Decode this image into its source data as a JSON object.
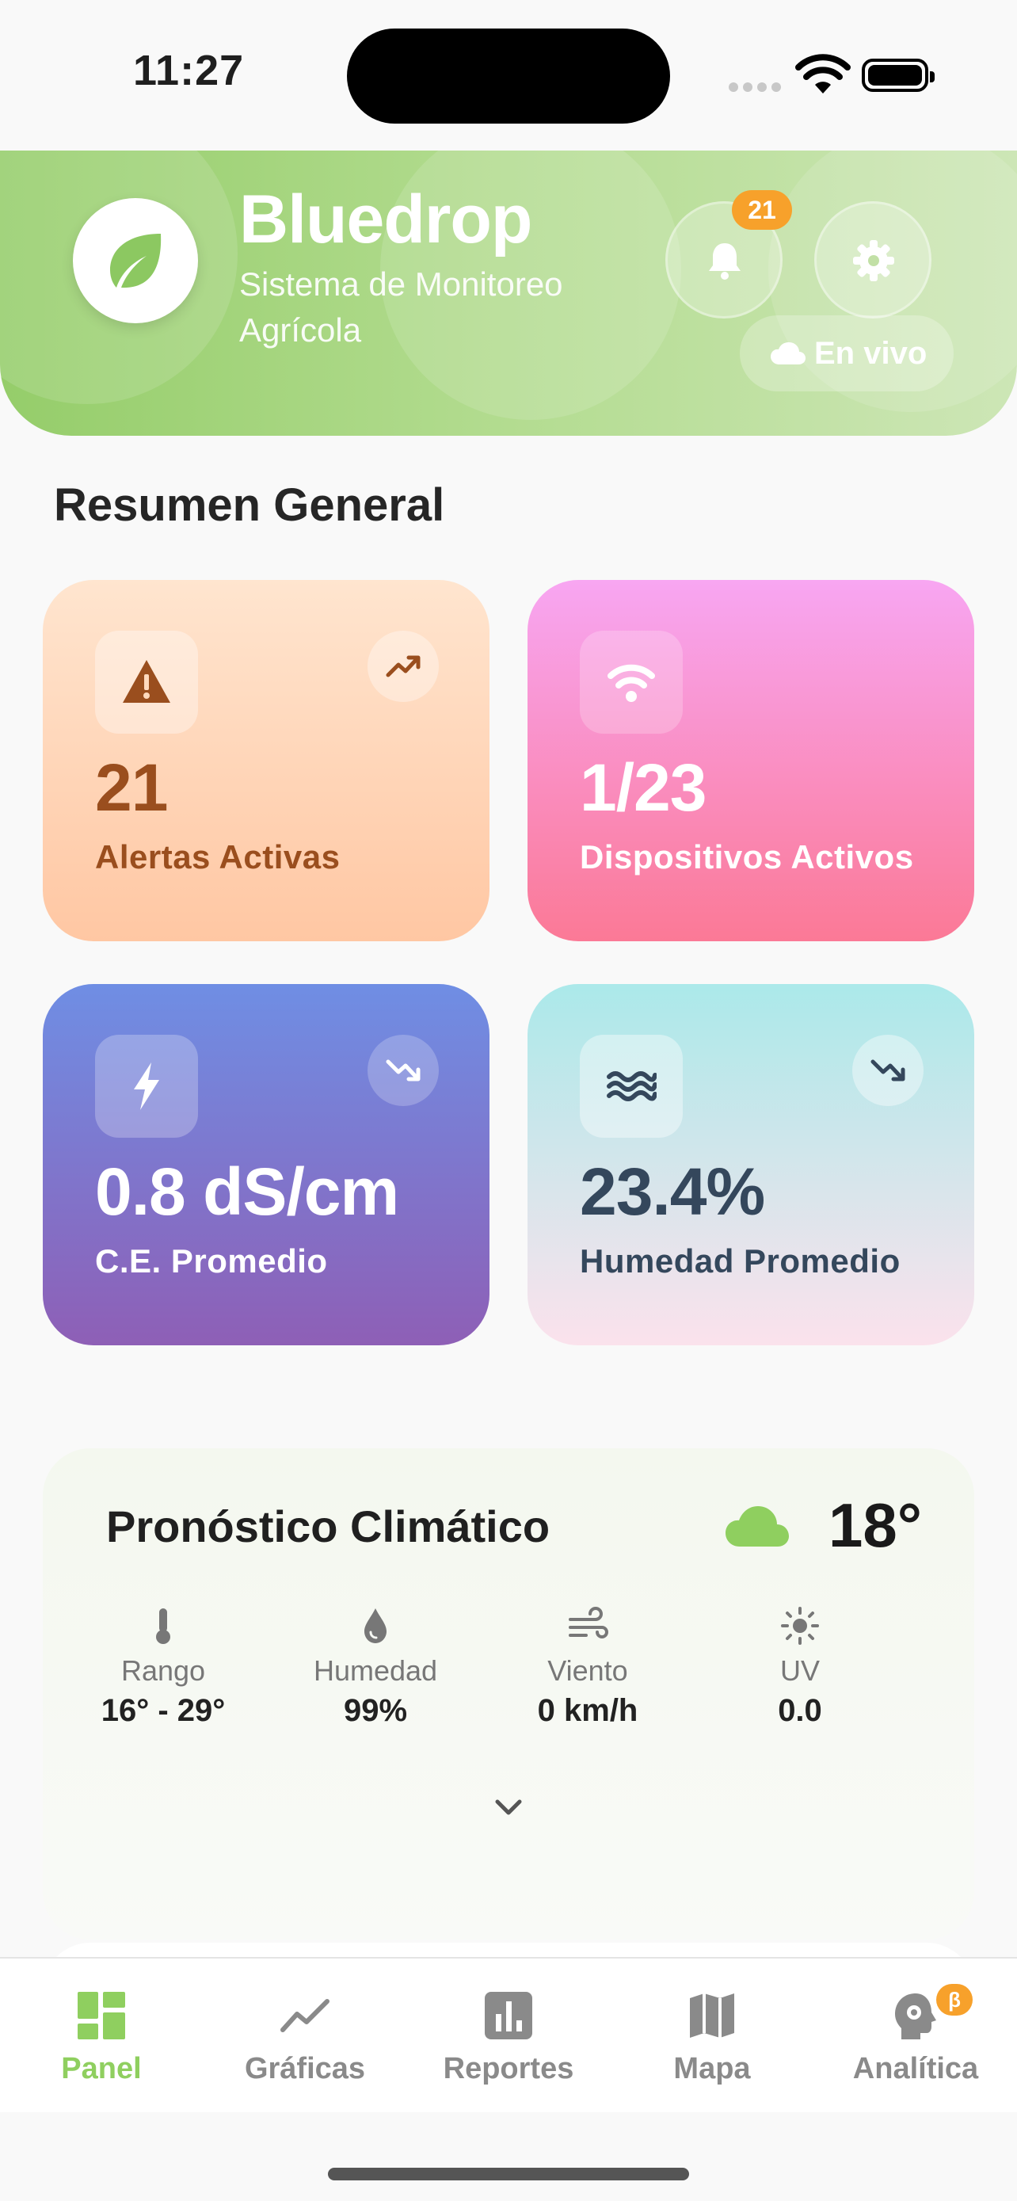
{
  "status_bar": {
    "time": "11:27"
  },
  "header": {
    "title": "Bluedrop",
    "subtitle": "Sistema de Monitoreo Agrícola",
    "notification_count": "21",
    "live_label": "En vivo"
  },
  "summary": {
    "title": "Resumen General",
    "cards": [
      {
        "value": "21",
        "label": "Alertas Activas",
        "icon": "warning-icon",
        "trend": "trend-up-icon"
      },
      {
        "value": "1/23",
        "label": "Dispositivos Activos",
        "icon": "wifi-icon"
      },
      {
        "value": "0.8 dS/cm",
        "label": "C.E. Promedio",
        "icon": "bolt-icon",
        "trend": "trend-down-icon"
      },
      {
        "value": "23.4%",
        "label": "Humedad Promedio",
        "icon": "waves-icon",
        "trend": "trend-down-icon"
      }
    ]
  },
  "weather": {
    "title": "Pronóstico Climático",
    "temperature": "18°",
    "stats": [
      {
        "key": "Rango",
        "value": "16° - 29°",
        "icon": "thermometer-icon"
      },
      {
        "key": "Humedad",
        "value": "99%",
        "icon": "drop-icon"
      },
      {
        "key": "Viento",
        "value": "0 km/h",
        "icon": "wind-icon"
      },
      {
        "key": "UV",
        "value": "0.0",
        "icon": "sun-icon"
      }
    ]
  },
  "tabs": [
    {
      "label": "Panel",
      "active": true
    },
    {
      "label": "Gráficas"
    },
    {
      "label": "Reportes"
    },
    {
      "label": "Mapa"
    },
    {
      "label": "Analítica",
      "badge": "β"
    }
  ],
  "colors": {
    "accent": "#8fcf5f",
    "badge": "#f7a12b",
    "header_start": "#95cd6a",
    "header_end": "#cde6b6"
  }
}
